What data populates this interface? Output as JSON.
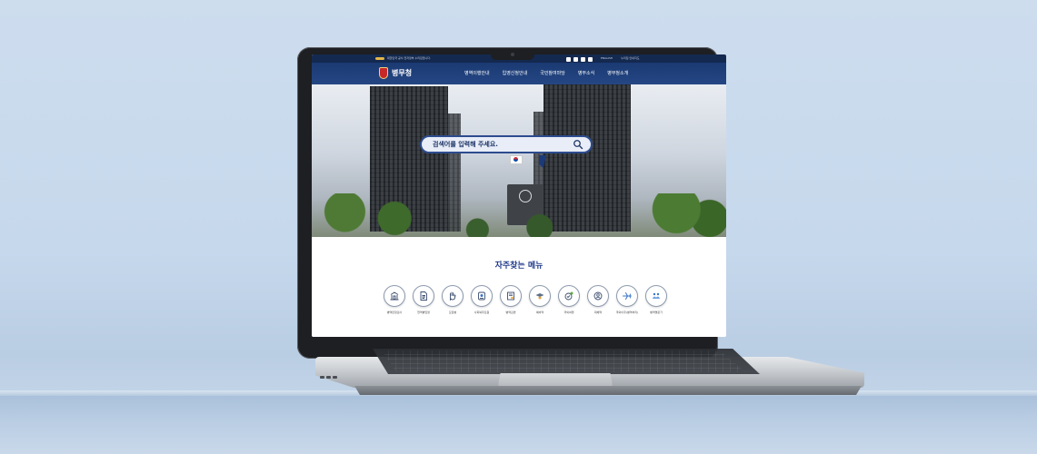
{
  "colors": {
    "background": "#c9dbee",
    "site_nav": "#1b3a73",
    "accent": "#1e3a8a",
    "search_border": "#2d4c8f"
  },
  "site": {
    "topbar": {
      "gov_notice": "대한민국 공식 전자정부 누리집입니다.",
      "social_icons": [
        "facebook-icon",
        "instagram-icon",
        "youtube-icon",
        "blog-icon"
      ],
      "language": "ENGLISH",
      "sitemap": "누리집 안내지도"
    },
    "logo_text": "병무청",
    "menu": [
      "병역이행안내",
      "입영신청안내",
      "국민참여마당",
      "병무소식",
      "병무청소개"
    ],
    "search": {
      "placeholder": "검색어를 입력해 주세요."
    },
    "frequent": {
      "title": "자주찾는 메뉴",
      "items": [
        {
          "label": "병역판정검사",
          "icon": "building-icon"
        },
        {
          "label": "현역병입영",
          "icon": "document-icon"
        },
        {
          "label": "모집병",
          "icon": "hand-icon"
        },
        {
          "label": "사회복무요원",
          "icon": "badge-icon"
        },
        {
          "label": "병역감면",
          "icon": "certificate-icon"
        },
        {
          "label": "예비역",
          "icon": "medal-icon"
        },
        {
          "label": "국외여행",
          "icon": "globe-check-icon"
        },
        {
          "label": "대체역",
          "icon": "person-circle-icon"
        },
        {
          "label": "국외이주(병역처리)",
          "icon": "airplane-icon"
        },
        {
          "label": "병역명문가",
          "icon": "family-icon"
        }
      ]
    }
  }
}
